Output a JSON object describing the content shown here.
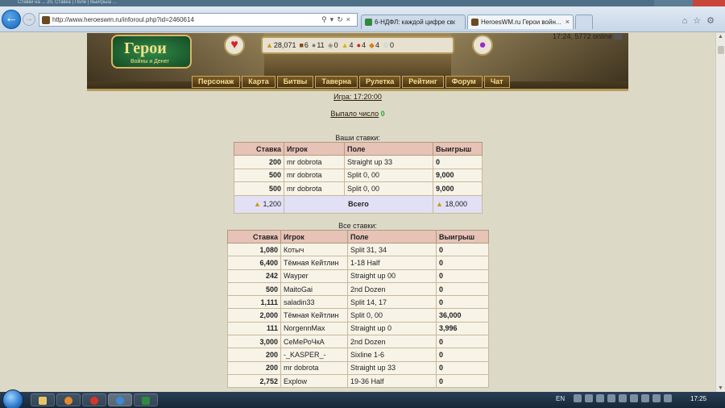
{
  "browser": {
    "ghost_title": "Ставки на ... 20, Ставка | Поле | Выигрыш ...",
    "url": "http://www.heroeswm.ru/inforoul.php?id=2460614",
    "tabs": [
      {
        "label": "6-НДФЛ: каждой цифре своя ..."
      },
      {
        "label": "HeroesWM.ru Герои войн..."
      }
    ]
  },
  "game": {
    "logo_main": "Герои",
    "logo_sub": "Войны и Денег",
    "clock_online": "17:24, 5772 online",
    "resources": [
      {
        "icon": "gold-icon",
        "value": "28,071"
      },
      {
        "icon": "wood-icon",
        "value": "6"
      },
      {
        "icon": "ore-icon",
        "value": "11"
      },
      {
        "icon": "mercury-icon",
        "value": "0"
      },
      {
        "icon": "sulfur-icon",
        "value": "4"
      },
      {
        "icon": "crystal-icon",
        "value": "4"
      },
      {
        "icon": "gems-icon",
        "value": "4"
      },
      {
        "icon": "diamond-icon",
        "value": "0"
      }
    ],
    "menu": [
      "Персонаж",
      "Карта",
      "Битвы",
      "Таверна",
      "Рулетка",
      "Рейтинг",
      "Форум",
      "Чат"
    ]
  },
  "roulette": {
    "game_label": "Игра: 17:20:00",
    "result_prefix": "Выпало число",
    "result_number": "0",
    "my_bets_title": "Ваши ставки:",
    "all_bets_title": "Все ставки:",
    "columns": [
      "Ставка",
      "Игрок",
      "Поле",
      "Выигрыш"
    ],
    "my_bets": [
      {
        "bet": "200",
        "player": "mr dobrota",
        "field": "Straight up 33",
        "win": "0"
      },
      {
        "bet": "500",
        "player": "mr dobrota",
        "field": "Split 0, 00",
        "win": "9,000"
      },
      {
        "bet": "500",
        "player": "mr dobrota",
        "field": "Split 0, 00",
        "win": "9,000"
      }
    ],
    "total": {
      "bet": "1,200",
      "label": "Всего",
      "win": "18,000"
    },
    "all_bets": [
      {
        "bet": "1,080",
        "player": "Котыч",
        "field": "Split 31, 34",
        "win": "0"
      },
      {
        "bet": "6,400",
        "player": "Тёмная Кейтлин",
        "field": "1-18 Half",
        "win": "0"
      },
      {
        "bet": "242",
        "player": "Wayper",
        "field": "Straight up 00",
        "win": "0"
      },
      {
        "bet": "500",
        "player": "MaitoGai",
        "field": "2nd Dozen",
        "win": "0"
      },
      {
        "bet": "1,111",
        "player": "saladin33",
        "field": "Split 14, 17",
        "win": "0"
      },
      {
        "bet": "2,000",
        "player": "Тёмная Кейтлин",
        "field": "Split 0, 00",
        "win": "36,000"
      },
      {
        "bet": "111",
        "player": "NorgennMax",
        "field": "Straight up 0",
        "win": "3,996"
      },
      {
        "bet": "3,000",
        "player": "СеМеРоЧкА",
        "field": "2nd Dozen",
        "win": "0"
      },
      {
        "bet": "200",
        "player": "-_KASPER_-",
        "field": "Sixline 1-6",
        "win": "0"
      },
      {
        "bet": "200",
        "player": "mr dobrota",
        "field": "Straight up 33",
        "win": "0"
      },
      {
        "bet": "2,752",
        "player": "Explow",
        "field": "19-36 Half",
        "win": "0"
      }
    ]
  },
  "taskbar": {
    "lang": "EN",
    "time": "17:25"
  }
}
